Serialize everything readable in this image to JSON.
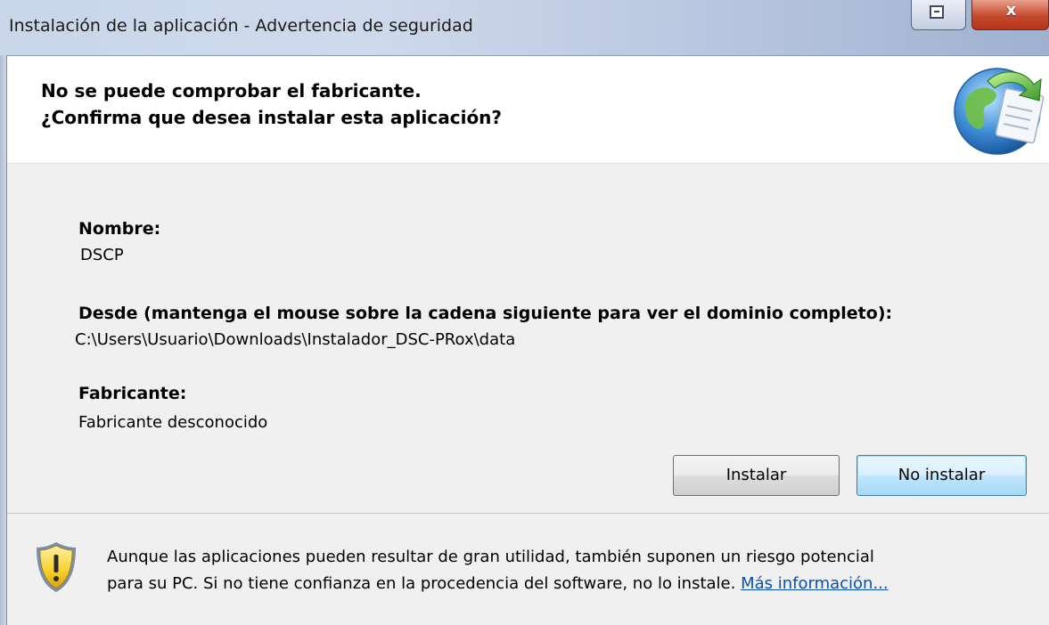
{
  "window": {
    "title": "Instalación de la aplicación - Advertencia de seguridad",
    "close_symbol": "x",
    "restore_icon": "restore-window-icon"
  },
  "header": {
    "line1": "No se puede comprobar el fabricante.",
    "line2": "¿Confirma que desea instalar esta aplicación?",
    "icon": "globe-install-icon"
  },
  "details": {
    "name_label": "Nombre:",
    "name_value": "DSCP",
    "from_label": "Desde (mantenga el mouse sobre la cadena siguiente para ver el dominio completo):",
    "from_value": "C:\\Users\\Usuario\\Downloads\\Instalador_DSC-PRox\\data",
    "publisher_label": "Fabricante:",
    "publisher_value": "Fabricante desconocido"
  },
  "buttons": {
    "install": "Instalar",
    "dont_install": "No instalar"
  },
  "footer": {
    "icon": "warning-shield-icon",
    "line1": "Aunque las aplicaciones pueden resultar de gran utilidad, también suponen un riesgo potencial",
    "line2_text": "para su PC. Si no tiene confianza en la procedencia del software, no lo instale. ",
    "more_info_link": "Más información..."
  },
  "colors": {
    "titlebar": "#c9d6ea",
    "close_button": "#c54a2f",
    "link": "#0a4fb5",
    "panel_background": "#f0f0f0"
  }
}
